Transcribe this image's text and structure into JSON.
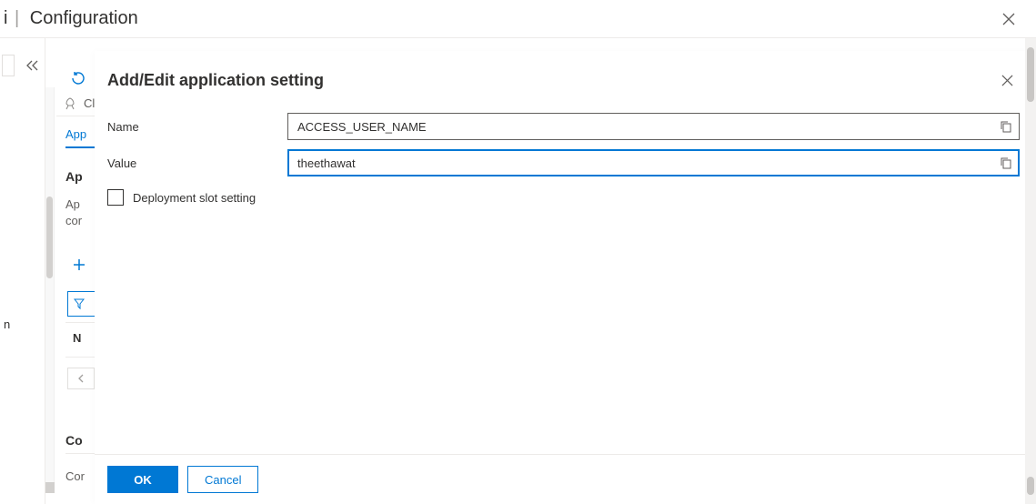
{
  "header": {
    "prefix": "i",
    "breadcrumb": "Configuration"
  },
  "leftNav": {
    "item_label_truncated": "n"
  },
  "underPanel": {
    "rocket_label": "Cl",
    "tab_label": "App",
    "section_heading": "Ap",
    "desc_line1": "Ap",
    "desc_line2": "cor",
    "col_header": "N",
    "co_heading": "Co",
    "co_text": "Cor"
  },
  "panel": {
    "title": "Add/Edit application setting",
    "fields": {
      "name_label": "Name",
      "name_value": "ACCESS_USER_NAME",
      "value_label": "Value",
      "value_value": "theethawat",
      "deployment_slot_label": "Deployment slot setting",
      "deployment_slot_checked": false
    },
    "buttons": {
      "ok": "OK",
      "cancel": "Cancel"
    }
  }
}
